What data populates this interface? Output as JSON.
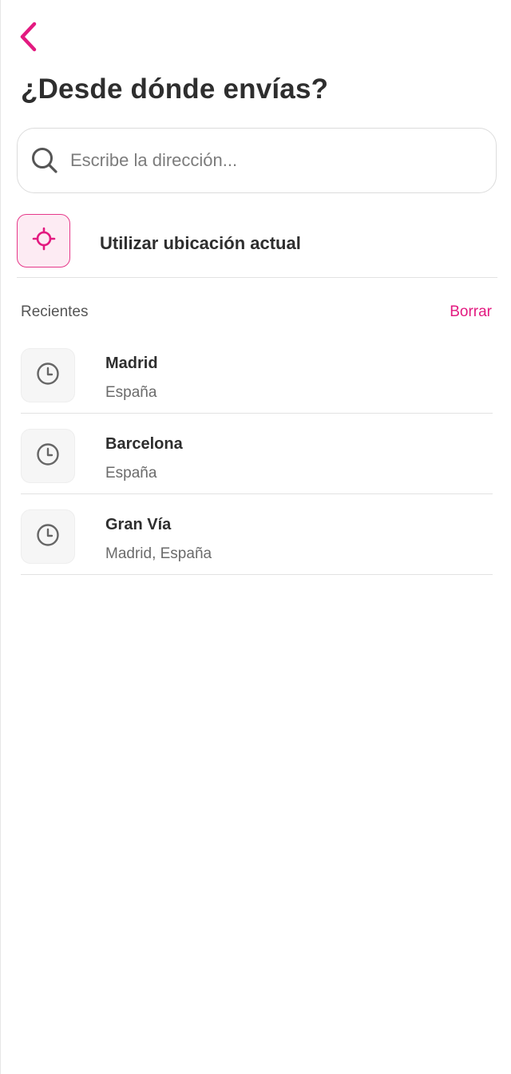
{
  "header": {
    "back_icon": "chevron-left-icon",
    "title": "¿Desde dónde envías?"
  },
  "search": {
    "icon": "search-icon",
    "placeholder": "Escribe la dirección...",
    "value": ""
  },
  "current_location": {
    "icon": "crosshair-icon",
    "label": "Utilizar ubicación actual"
  },
  "recents": {
    "title": "Recientes",
    "clear_label": "Borrar",
    "items": [
      {
        "icon": "clock-icon",
        "name": "Madrid",
        "subtitle": "España"
      },
      {
        "icon": "clock-icon",
        "name": "Barcelona",
        "subtitle": "España"
      },
      {
        "icon": "clock-icon",
        "name": "Gran Vía",
        "subtitle": "Madrid, España"
      }
    ]
  },
  "colors": {
    "accent": "#e31a80",
    "accent_bg": "#fdebf3",
    "text": "#2e2e2e",
    "muted": "#6b6b6b",
    "divider": "#e2e2e2"
  }
}
